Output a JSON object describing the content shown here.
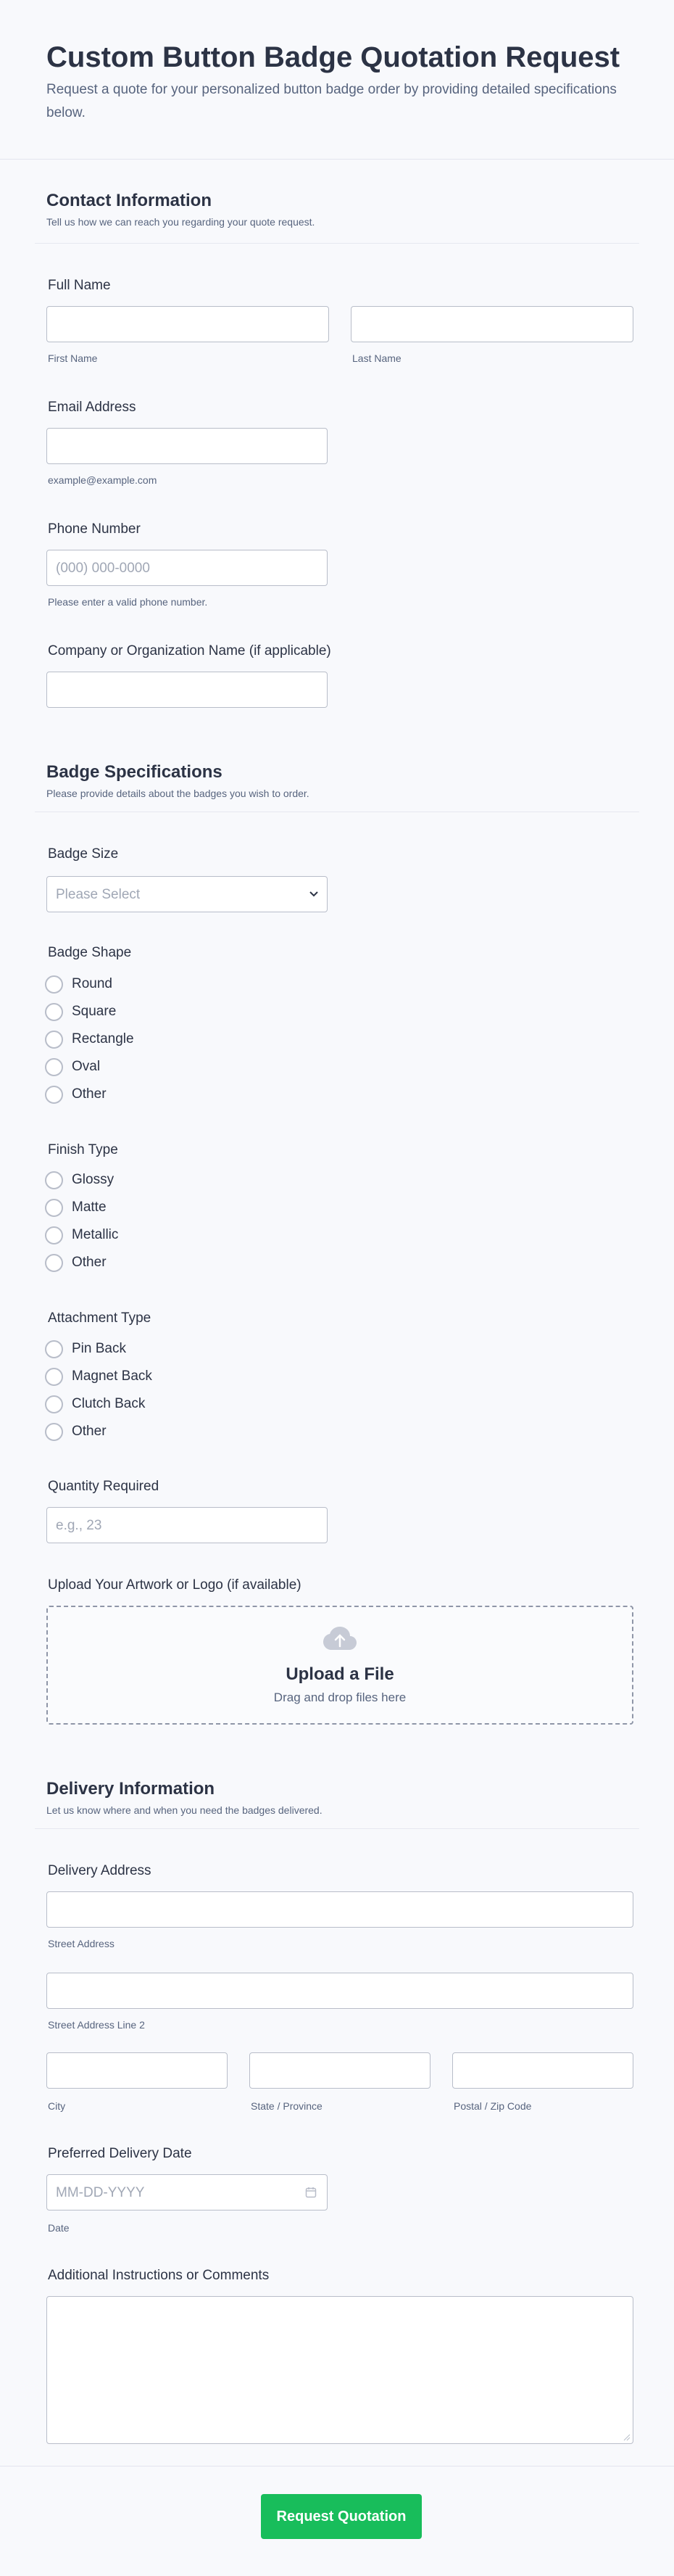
{
  "header": {
    "title": "Custom Button Badge Quotation Request",
    "subtitle": "Request a quote for your personalized button badge order by providing detailed specifications below."
  },
  "contact": {
    "title": "Contact Information",
    "desc": "Tell us how we can reach you regarding your quote request.",
    "full_name_label": "Full Name",
    "first_name_sublabel": "First Name",
    "last_name_sublabel": "Last Name",
    "email_label": "Email Address",
    "email_sublabel": "example@example.com",
    "phone_label": "Phone Number",
    "phone_placeholder": "(000) 000-0000",
    "phone_sublabel": "Please enter a valid phone number.",
    "company_label": "Company or Organization Name (if applicable)"
  },
  "badge": {
    "title": "Badge Specifications",
    "desc": "Please provide details about the badges you wish to order.",
    "size_label": "Badge Size",
    "size_placeholder": "Please Select",
    "shape_label": "Badge Shape",
    "shapes": [
      "Round",
      "Square",
      "Rectangle",
      "Oval",
      "Other"
    ],
    "finish_label": "Finish Type",
    "finishes": [
      "Glossy",
      "Matte",
      "Metallic",
      "Other"
    ],
    "attachment_label": "Attachment Type",
    "attachments": [
      "Pin Back",
      "Magnet Back",
      "Clutch Back",
      "Other"
    ],
    "quantity_label": "Quantity Required",
    "quantity_placeholder": "e.g., 23",
    "upload_label": "Upload Your Artwork or Logo (if available)",
    "upload_title": "Upload a File",
    "upload_sub": "Drag and drop files here"
  },
  "delivery": {
    "title": "Delivery Information",
    "desc": "Let us know where and when you need the badges delivered.",
    "address_label": "Delivery Address",
    "street_sublabel": "Street Address",
    "street2_sublabel": "Street Address Line 2",
    "city_sublabel": "City",
    "state_sublabel": "State / Province",
    "zip_sublabel": "Postal / Zip Code",
    "date_label": "Preferred Delivery Date",
    "date_placeholder": "MM-DD-YYYY",
    "date_sublabel": "Date",
    "comments_label": "Additional Instructions or Comments"
  },
  "submit_label": "Request Quotation",
  "colors": {
    "accent": "#18bd5b",
    "text": "#2c3345",
    "muted": "#57647e",
    "border": "#b8bdc9"
  }
}
